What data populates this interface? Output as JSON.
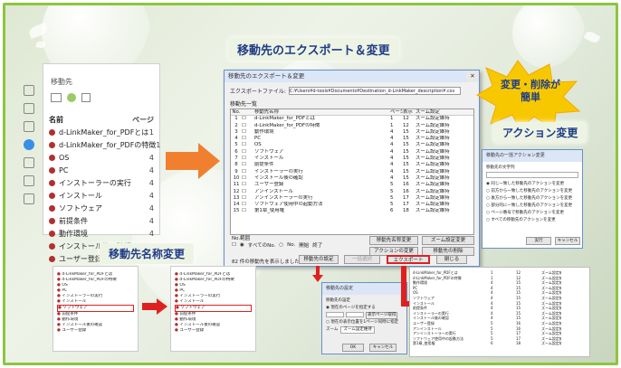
{
  "titles": {
    "main": "移動先のエクスポート＆変更",
    "burst_line1": "変更・削除が",
    "burst_line2": "簡単",
    "action": "アクション変更",
    "rename": "移動先名称変更"
  },
  "sidebar": {
    "header": "移動先",
    "col_name": "名前",
    "col_page": "ページ",
    "items": [
      {
        "label": "d-LinkMaker_for_PDFとは",
        "page": "1"
      },
      {
        "label": "d-LinkMaker_for_PDFの特徴",
        "page": "1"
      },
      {
        "label": "OS",
        "page": "4"
      },
      {
        "label": "PC",
        "page": "4"
      },
      {
        "label": "インストーラーの実行",
        "page": "4"
      },
      {
        "label": "インストール",
        "page": "4"
      },
      {
        "label": "ソフトウェア",
        "page": "4"
      },
      {
        "label": "前提条件",
        "page": "4"
      },
      {
        "label": "動作環境",
        "page": "4"
      },
      {
        "label": "インストール後の確認",
        "page": "4"
      },
      {
        "label": "ユーザー登録",
        "page": "5"
      }
    ]
  },
  "dialog": {
    "title": "移動先のエクスポート＆変更",
    "file_label": "エクスポートファイル:",
    "file_value": "C:¥Users¥d-tools¥Documents¥Destination_d-LinkMaker_description¥.csv",
    "list_label": "移動先一覧",
    "headers": [
      "No.",
      "",
      "移動先名称",
      "ページ",
      "表示",
      "ズーム設定"
    ],
    "rows": [
      [
        "1",
        "",
        "d-LinkMaker_for_PDFとは",
        "1",
        "12",
        "ズーム設定維持"
      ],
      [
        "2",
        "",
        "d-LinkMaker_for_PDFの特徴",
        "1",
        "12",
        "ズーム設定維持"
      ],
      [
        "3",
        "",
        "動作環境",
        "4",
        "15",
        "ズーム設定維持"
      ],
      [
        "4",
        "",
        "PC",
        "4",
        "15",
        "ズーム設定維持"
      ],
      [
        "5",
        "",
        "OS",
        "4",
        "15",
        "ズーム設定維持"
      ],
      [
        "6",
        "",
        "ソフトウェア",
        "4",
        "15",
        "ズーム設定維持"
      ],
      [
        "7",
        "",
        "インストール",
        "4",
        "15",
        "ズーム設定維持"
      ],
      [
        "8",
        "",
        "前提条件",
        "4",
        "15",
        "ズーム設定維持"
      ],
      [
        "9",
        "",
        "インストーラーの実行",
        "4",
        "15",
        "ズーム設定維持"
      ],
      [
        "10",
        "",
        "インストール後の確認",
        "4",
        "15",
        "ズーム設定維持"
      ],
      [
        "11",
        "",
        "ユーザー登録",
        "5",
        "16",
        "ズーム設定維持"
      ],
      [
        "12",
        "",
        "アンインストール",
        "5",
        "16",
        "ズーム設定維持"
      ],
      [
        "13",
        "",
        "アンインストーラーの実行",
        "5",
        "17",
        "ズーム設定維持"
      ],
      [
        "14",
        "",
        "ソフトウェア使用中の起動方法",
        "5",
        "17",
        "ズーム設定維持"
      ],
      [
        "15",
        "",
        "第1章_使用権",
        "6",
        "18",
        "ズーム設定維持"
      ]
    ],
    "range_label": "No.範囲",
    "all_label": "すべてのNo.",
    "no_label": "No.",
    "start_label": "開始",
    "end_label": "終了",
    "btn_rename": "移動先名称変更",
    "btn_zoom": "ズーム設定変更",
    "btn_action": "アクションの変更",
    "btn_delete": "移動先の削除",
    "status": "82 件の移動先を表示しました。",
    "btn_set": "移動先の設定",
    "btn_all": "一括選択",
    "btn_export": "エクスポート",
    "btn_close": "閉じる"
  },
  "action_dialog": {
    "title": "移動先の一括アクション変更",
    "label": "移動先の文字列",
    "opt1": "同じ一致した移動先のアクションを変更",
    "opt2": "前方から一致した移動先のアクションを変更",
    "opt3": "後方から一致した移動先のアクションを変更",
    "opt4": "部分的に一致した移動先のアクションを変更",
    "opt5": "ページ番号で移動先のアクションを変更",
    "opt6": "すべての移動先のアクションを変更",
    "ok": "実行",
    "cancel": "キャンセル"
  },
  "set_dialog": {
    "title": "移動先の設定",
    "label": "移動先の設定",
    "opt1": "現在のページを指定する",
    "opt2": "現在の表示位置を1ページ同時に指定",
    "zoom_label": "ズーム",
    "zoom_value": "ズーム設定維持",
    "btn": "表示ページ取得",
    "ok": "OK",
    "cancel": "キャンセル"
  },
  "colors": {
    "border": "#8cc63f",
    "title": "#1f3c86",
    "arrow": "#f08030",
    "red": "#e02020",
    "burst": "#f7c800"
  }
}
